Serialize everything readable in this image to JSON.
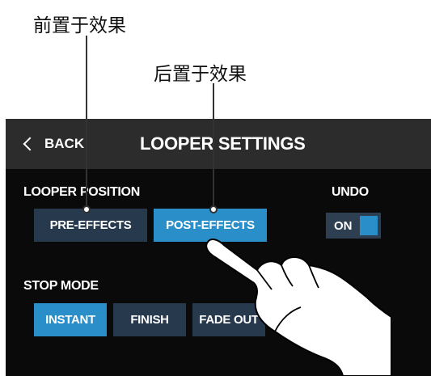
{
  "callouts": {
    "pre_effects": "前置于效果",
    "post_effects": "后置于效果"
  },
  "header": {
    "back_label": "BACK",
    "title": "LOOPER SETTINGS"
  },
  "looper_position": {
    "label": "LOOPER POSITION",
    "options": [
      "PRE-EFFECTS",
      "POST-EFFECTS"
    ],
    "selected": "POST-EFFECTS"
  },
  "undo": {
    "label": "UNDO",
    "state": "ON"
  },
  "stop_mode": {
    "label": "STOP MODE",
    "options": [
      "INSTANT",
      "FINISH",
      "FADE OUT"
    ],
    "selected": "INSTANT"
  },
  "icons": {
    "back": "chevron-left-icon",
    "pointer": "pointing-hand-icon"
  },
  "colors": {
    "screen_bg": "#0a0a0a",
    "titlebar_bg": "#2c2c2c",
    "selected_button": "#2a8ec8",
    "unselected_button": "#26394d"
  }
}
